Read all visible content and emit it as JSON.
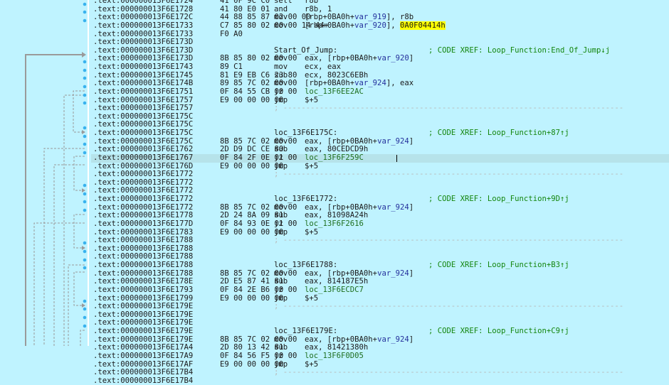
{
  "rows": [
    {
      "addr": ".text:000000013F6E1724",
      "bytes": "41 0F 9C C0",
      "mn": "setl",
      "op": "r8b"
    },
    {
      "addr": ".text:000000013F6E1728",
      "bytes": "41 80 E0 01",
      "mn": "and",
      "op": "r8b, 1"
    },
    {
      "addr": ".text:000000013F6E172C",
      "bytes": "44 88 85 87 02 00 00",
      "mn": "mov",
      "op_pre": "[rbp+0BA0h+",
      "op_var": "var_919",
      "op_post": "], r8b"
    },
    {
      "addr": ".text:000000013F6E1733",
      "bytes": "C7 85 80 02 00 00 14 44+",
      "mn": "mov",
      "op_pre": "[rbp+0BA0h+",
      "op_var": "var_920",
      "op_post": "], ",
      "op_hl": "0A0F04414h"
    },
    {
      "addr": ".text:000000013F6E1733",
      "bytes": "F0 A0"
    },
    {
      "addr": ".text:000000013F6E173D"
    },
    {
      "addr": ".text:000000013F6E173D",
      "label": "Start_Of_Jump:",
      "comment": "; CODE XREF: Loop_Function:End_Of_Jump↓j"
    },
    {
      "addr": ".text:000000013F6E173D",
      "bytes": "8B 85 80 02 00 00",
      "mn": "mov",
      "op_pre": "eax, [rbp+0BA0h+",
      "op_var": "var_920",
      "op_post": "]"
    },
    {
      "addr": ".text:000000013F6E1743",
      "bytes": "89 C1",
      "mn": "mov",
      "op": "ecx, eax"
    },
    {
      "addr": ".text:000000013F6E1745",
      "bytes": "81 E9 EB C6 23 80",
      "mn": "sub",
      "op": "ecx, 8023C6EBh"
    },
    {
      "addr": ".text:000000013F6E174B",
      "bytes": "89 85 7C 02 00 00",
      "mn": "mov",
      "op_pre": "[rbp+0BA0h+",
      "op_var": "var_924",
      "op_post": "], eax"
    },
    {
      "addr": ".text:000000013F6E1751",
      "bytes": "0F 84 55 CB 00 00",
      "mn": "jz",
      "op_loc": "loc_13F6EE2AC"
    },
    {
      "addr": ".text:000000013F6E1757",
      "bytes": "E9 00 00 00 00",
      "mn": "jmp",
      "op": "$+5"
    },
    {
      "addr": ".text:000000013F6E1757",
      "sep": "; ---------------------------------------------------------------------------"
    },
    {
      "addr": ".text:000000013F6E175C"
    },
    {
      "addr": ".text:000000013F6E175C"
    },
    {
      "addr": ".text:000000013F6E175C",
      "label": "loc_13F6E175C:",
      "comment": "; CODE XREF: Loop_Function+87↑j"
    },
    {
      "addr": ".text:000000013F6E175C",
      "bytes": "8B 85 7C 02 00 00",
      "mn": "mov",
      "op_pre": "eax, [rbp+0BA0h+",
      "op_var": "var_924",
      "op_post": "]"
    },
    {
      "addr": ".text:000000013F6E1762",
      "bytes": "2D D9 DC CE 80",
      "mn": "sub",
      "op": "eax, 80CEDCD9h"
    },
    {
      "addr": ".text:000000013F6E1767",
      "bytes": "0F 84 2F 0E 01 00",
      "mn": "jz",
      "op_loc": "loc_13F6F259C",
      "selected": true,
      "cursor": true
    },
    {
      "addr": ".text:000000013F6E176D",
      "bytes": "E9 00 00 00 00",
      "mn": "jmp",
      "op": "$+5"
    },
    {
      "addr": ".text:000000013F6E1772",
      "sep": "; ---------------------------------------------------------------------------"
    },
    {
      "addr": ".text:000000013F6E1772"
    },
    {
      "addr": ".text:000000013F6E1772"
    },
    {
      "addr": ".text:000000013F6E1772",
      "label": "loc_13F6E1772:",
      "comment": "; CODE XREF: Loop_Function+9D↑j"
    },
    {
      "addr": ".text:000000013F6E1772",
      "bytes": "8B 85 7C 02 00 00",
      "mn": "mov",
      "op_pre": "eax, [rbp+0BA0h+",
      "op_var": "var_924",
      "op_post": "]"
    },
    {
      "addr": ".text:000000013F6E1778",
      "bytes": "2D 24 8A 09 81",
      "mn": "sub",
      "op": "eax, 81098A24h"
    },
    {
      "addr": ".text:000000013F6E177D",
      "bytes": "0F 84 93 0E 01 00",
      "mn": "jz",
      "op_loc": "loc_13F6F2616"
    },
    {
      "addr": ".text:000000013F6E1783",
      "bytes": "E9 00 00 00 00",
      "mn": "jmp",
      "op": "$+5"
    },
    {
      "addr": ".text:000000013F6E1788",
      "sep": "; ---------------------------------------------------------------------------"
    },
    {
      "addr": ".text:000000013F6E1788"
    },
    {
      "addr": ".text:000000013F6E1788"
    },
    {
      "addr": ".text:000000013F6E1788",
      "label": "loc_13F6E1788:",
      "comment": "; CODE XREF: Loop_Function+B3↑j"
    },
    {
      "addr": ".text:000000013F6E1788",
      "bytes": "8B 85 7C 02 00 00",
      "mn": "mov",
      "op_pre": "eax, [rbp+0BA0h+",
      "op_var": "var_924",
      "op_post": "]"
    },
    {
      "addr": ".text:000000013F6E178E",
      "bytes": "2D E5 87 41 81",
      "mn": "sub",
      "op": "eax, 814187E5h"
    },
    {
      "addr": ".text:000000013F6E1793",
      "bytes": "0F 84 2E B6 00 00",
      "mn": "jz",
      "op_loc": "loc_13F6ECDC7"
    },
    {
      "addr": ".text:000000013F6E1799",
      "bytes": "E9 00 00 00 00",
      "mn": "jmp",
      "op": "$+5"
    },
    {
      "addr": ".text:000000013F6E179E",
      "sep": "; ---------------------------------------------------------------------------"
    },
    {
      "addr": ".text:000000013F6E179E"
    },
    {
      "addr": ".text:000000013F6E179E"
    },
    {
      "addr": ".text:000000013F6E179E",
      "label": "loc_13F6E179E:",
      "comment": "; CODE XREF: Loop_Function+C9↑j"
    },
    {
      "addr": ".text:000000013F6E179E",
      "bytes": "8B 85 7C 02 00 00",
      "mn": "mov",
      "op_pre": "eax, [rbp+0BA0h+",
      "op_var": "var_924",
      "op_post": "]"
    },
    {
      "addr": ".text:000000013F6E17A4",
      "bytes": "2D 80 13 42 81",
      "mn": "sub",
      "op": "eax, 81421380h"
    },
    {
      "addr": ".text:000000013F6E17A9",
      "bytes": "0F 84 56 F5 00 00",
      "mn": "jz",
      "op_loc": "loc_13F6F0D05"
    },
    {
      "addr": ".text:000000013F6E17AF",
      "bytes": "E9 00 00 00 00",
      "mn": "jmp",
      "op": "$+5"
    },
    {
      "addr": ".text:000000013F6E17B4",
      "sep": "; ---------------------------------------------------------------------------"
    },
    {
      "addr": ".text:000000013F6E17B4"
    }
  ]
}
